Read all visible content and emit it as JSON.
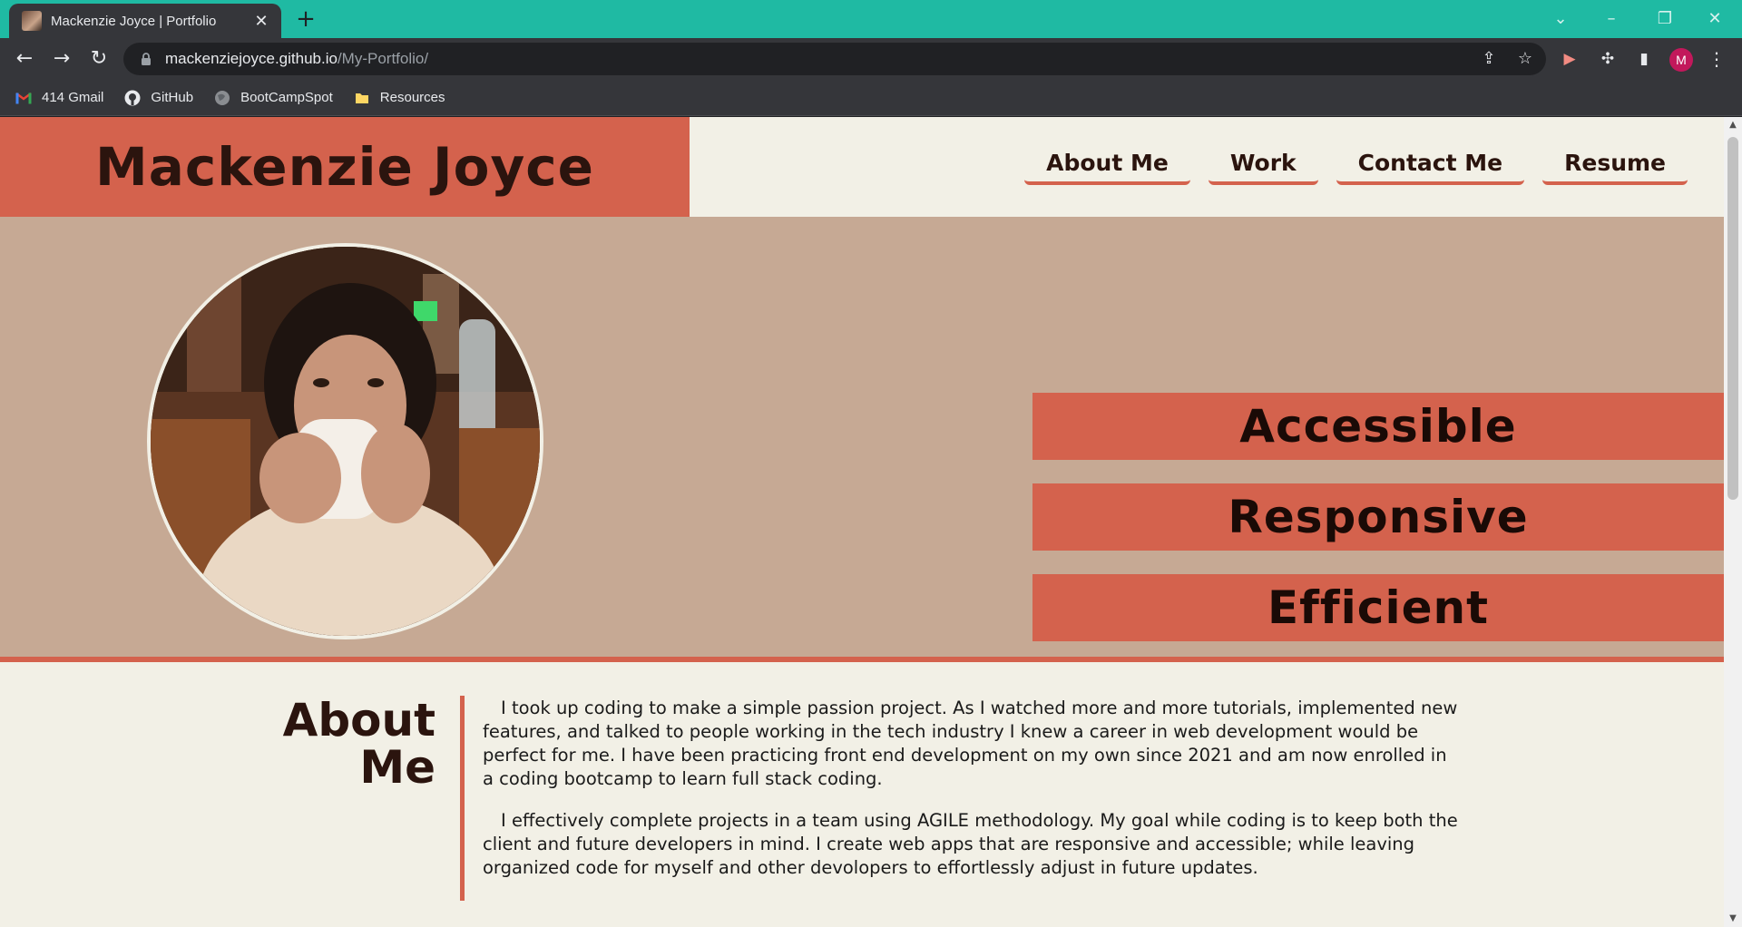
{
  "browser": {
    "tab_title": "Mackenzie Joyce | Portfolio",
    "url_host": "mackenziejoyce.github.io",
    "url_path": "/My-Portfolio/",
    "profile_initial": "M",
    "bookmarks": [
      {
        "label": "414 Gmail",
        "icon": "gmail-icon"
      },
      {
        "label": "GitHub",
        "icon": "github-icon"
      },
      {
        "label": "BootCampSpot",
        "icon": "globe-icon"
      },
      {
        "label": "Resources",
        "icon": "folder-icon"
      }
    ],
    "colors": {
      "tabstrip": "#1fbaa3",
      "toolbar": "#35363a",
      "profile": "#c2185b"
    }
  },
  "site": {
    "name": "Mackenzie Joyce",
    "nav": [
      "About Me",
      "Work",
      "Contact Me",
      "Resume"
    ],
    "hero_words": [
      "Accessible",
      "Responsive",
      "Efficient"
    ],
    "about": {
      "heading_line1": "About",
      "heading_line2": "Me",
      "paragraphs": [
        "I took up coding to make a simple passion project. As I watched more and more tutorials, implemented new features, and talked to people working in the tech industry I knew a career in web development would be perfect for me. I have been practicing front end development on my own since 2021 and am now enrolled in a coding bootcamp to learn full stack coding.",
        "I effectively complete projects in a team using AGILE methodology. My goal while coding is to keep both the client and future developers in mind. I create web apps that are responsive and accessible; while leaving organized code for myself and other devolopers to effortlessly adjust in future updates."
      ]
    },
    "colors": {
      "accent": "#d4624d",
      "hero_bg": "#c6a994",
      "page_bg": "#f2f0e6",
      "text_dark": "#2b140e"
    }
  }
}
